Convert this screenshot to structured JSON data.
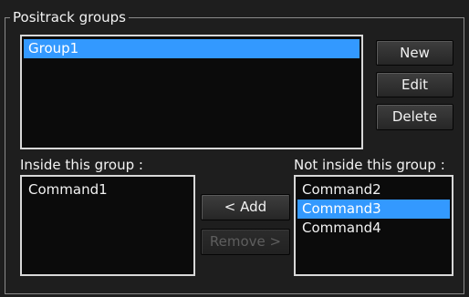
{
  "groups_box": {
    "title": "Positrack groups",
    "items": [
      {
        "label": "Group1",
        "selected": true
      }
    ]
  },
  "buttons": {
    "new": "New",
    "edit": "Edit",
    "delete": "Delete",
    "add": "< Add",
    "remove": "Remove >"
  },
  "inside_group": {
    "label": "Inside this group :",
    "items": [
      "Command1"
    ]
  },
  "not_inside_group": {
    "label": "Not inside this group :",
    "items": [
      "Command2",
      "Command3",
      "Command4"
    ],
    "selected_item": "Command3"
  },
  "colors": {
    "selection": "#3399ff",
    "list_background": "#0b0b0b",
    "panel_background": "#1e1e1e"
  }
}
